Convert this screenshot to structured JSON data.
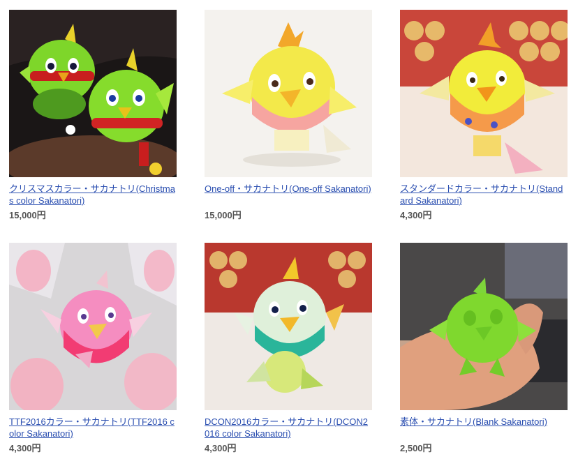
{
  "products": [
    {
      "name": "クリスマスカラー・サカナトリ(Christmas color Sakanatori)",
      "price": "15,000円",
      "image": "christmas-green-figures"
    },
    {
      "name": "One-off・サカナトリ(One-off Sakanatori)",
      "price": "15,000円",
      "image": "yellow-pink-figure"
    },
    {
      "name": "スタンダードカラー・サカナトリ(Standard Sakanatori)",
      "price": "4,300円",
      "image": "yellow-orange-figure"
    },
    {
      "name": "TTF2016カラー・サカナトリ(TTF2016 color Sakanatori)",
      "price": "4,300円",
      "image": "pink-figures-in-bags"
    },
    {
      "name": "DCON2016カラー・サカナトリ(DCON2016 color Sakanatori)",
      "price": "4,300円",
      "image": "white-green-figure"
    },
    {
      "name": "素体・サカナトリ(Blank Sakanatori)",
      "price": "2,500円",
      "image": "green-blank-figure-in-hand"
    }
  ],
  "colors": {
    "link": "#2a4eb0",
    "price": "#555555"
  }
}
